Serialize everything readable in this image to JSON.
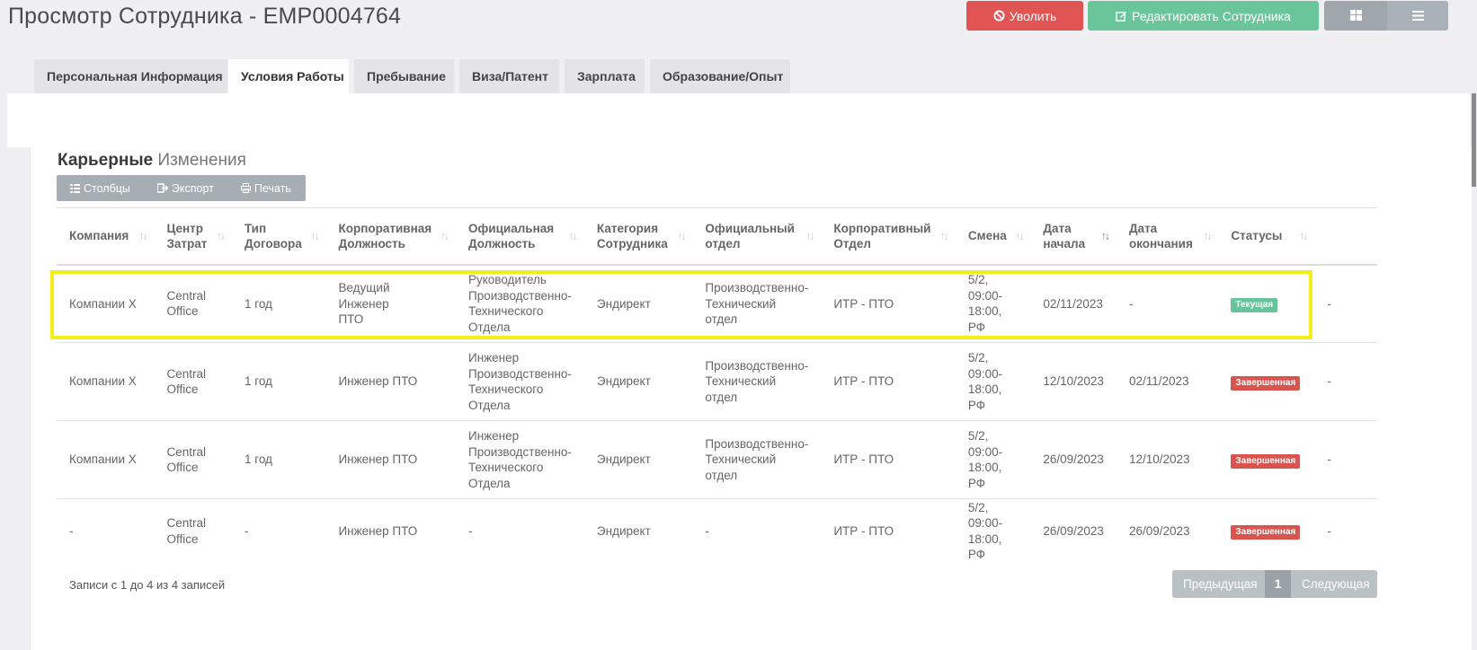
{
  "page": {
    "title": "Просмотр Сотрудника - EMP0004764"
  },
  "actions": {
    "dismiss_label": "Уволить",
    "edit_label": "Редактировать Сотрудника",
    "grid_view_icon": "grid-icon",
    "list_view_icon": "list-icon"
  },
  "tabs": [
    {
      "label": "Персональная Информация",
      "active": false
    },
    {
      "label": "Условия Работы",
      "active": true
    },
    {
      "label": "Пребывание",
      "active": false
    },
    {
      "label": "Виза/Патент",
      "active": false
    },
    {
      "label": "Зарплата",
      "active": false
    },
    {
      "label": "Образование/Опыт",
      "active": false
    }
  ],
  "section": {
    "title_bold": "Карьерные",
    "title_light": "Изменения"
  },
  "toolbar": {
    "columns_label": "Столбцы",
    "export_label": "Экспорт",
    "print_label": "Печать"
  },
  "table": {
    "headers": [
      [
        "Компания",
        ""
      ],
      [
        "Центр",
        "Затрат"
      ],
      [
        "Тип",
        "Договора"
      ],
      [
        "Корпоративная",
        "Должность"
      ],
      [
        "Официальная",
        "Должность"
      ],
      [
        "Категория",
        "Сотрудника"
      ],
      [
        "Официальный",
        "отдел"
      ],
      [
        "Корпоративный",
        "Отдел"
      ],
      [
        "Смена",
        ""
      ],
      [
        "Дата",
        "начала"
      ],
      [
        "Дата",
        "окончания"
      ],
      [
        "Статусы",
        ""
      ]
    ],
    "rows": [
      {
        "company": "Компании Х",
        "cost_center": [
          "Central",
          "Office"
        ],
        "contract": "1 год",
        "corp_position": [
          "Ведущий Инженер",
          "ПТО"
        ],
        "official_position": [
          "Руководитель",
          "Производственно-",
          "Технического",
          "Отдела"
        ],
        "category": "Эндирект",
        "official_dept": [
          "Производственно-",
          "Технический",
          "отдел"
        ],
        "corp_dept": "ИТР - ПТО",
        "shift": [
          "5/2,",
          "09:00-",
          "18:00, РФ"
        ],
        "start": "02/11/2023",
        "end": "-",
        "status": "Текущая",
        "status_type": "current",
        "extra": "-"
      },
      {
        "company": "Компании Х",
        "cost_center": [
          "Central",
          "Office"
        ],
        "contract": "1 год",
        "corp_position": [
          "Инженер ПТО"
        ],
        "official_position": [
          "Инженер",
          "Производственно-",
          "Технического",
          "Отдела"
        ],
        "category": "Эндирект",
        "official_dept": [
          "Производственно-",
          "Технический",
          "отдел"
        ],
        "corp_dept": "ИТР - ПТО",
        "shift": [
          "5/2,",
          "09:00-",
          "18:00, РФ"
        ],
        "start": "12/10/2023",
        "end": "02/11/2023",
        "status": "Завершенная",
        "status_type": "done",
        "extra": "-"
      },
      {
        "company": "Компании Х",
        "cost_center": [
          "Central",
          "Office"
        ],
        "contract": "1 год",
        "corp_position": [
          "Инженер ПТО"
        ],
        "official_position": [
          "Инженер",
          "Производственно-",
          "Технического",
          "Отдела"
        ],
        "category": "Эндирект",
        "official_dept": [
          "Производственно-",
          "Технический",
          "отдел"
        ],
        "corp_dept": "ИТР - ПТО",
        "shift": [
          "5/2,",
          "09:00-",
          "18:00, РФ"
        ],
        "start": "26/09/2023",
        "end": "12/10/2023",
        "status": "Завершенная",
        "status_type": "done",
        "extra": "-"
      },
      {
        "company": "-",
        "cost_center": [
          "Central",
          "Office"
        ],
        "contract": "-",
        "corp_position": [
          "Инженер ПТО"
        ],
        "official_position": [
          "-"
        ],
        "category": "Эндирект",
        "official_dept": [
          "-"
        ],
        "corp_dept": "ИТР - ПТО",
        "shift": [
          "5/2,",
          "09:00-",
          "18:00, РФ"
        ],
        "start": "26/09/2023",
        "end": "26/09/2023",
        "status": "Завершенная",
        "status_type": "done",
        "extra": "-"
      }
    ]
  },
  "footer": {
    "records_info": "Записи с 1 до 4 из 4 записей",
    "prev_label": "Предыдущая",
    "page_number": "1",
    "next_label": "Следующая"
  },
  "colors": {
    "danger": "#e05454",
    "success": "#6ac59a",
    "badge_current": "#67c39a",
    "badge_done": "#d9534f",
    "highlight": "#f4ef1a"
  }
}
